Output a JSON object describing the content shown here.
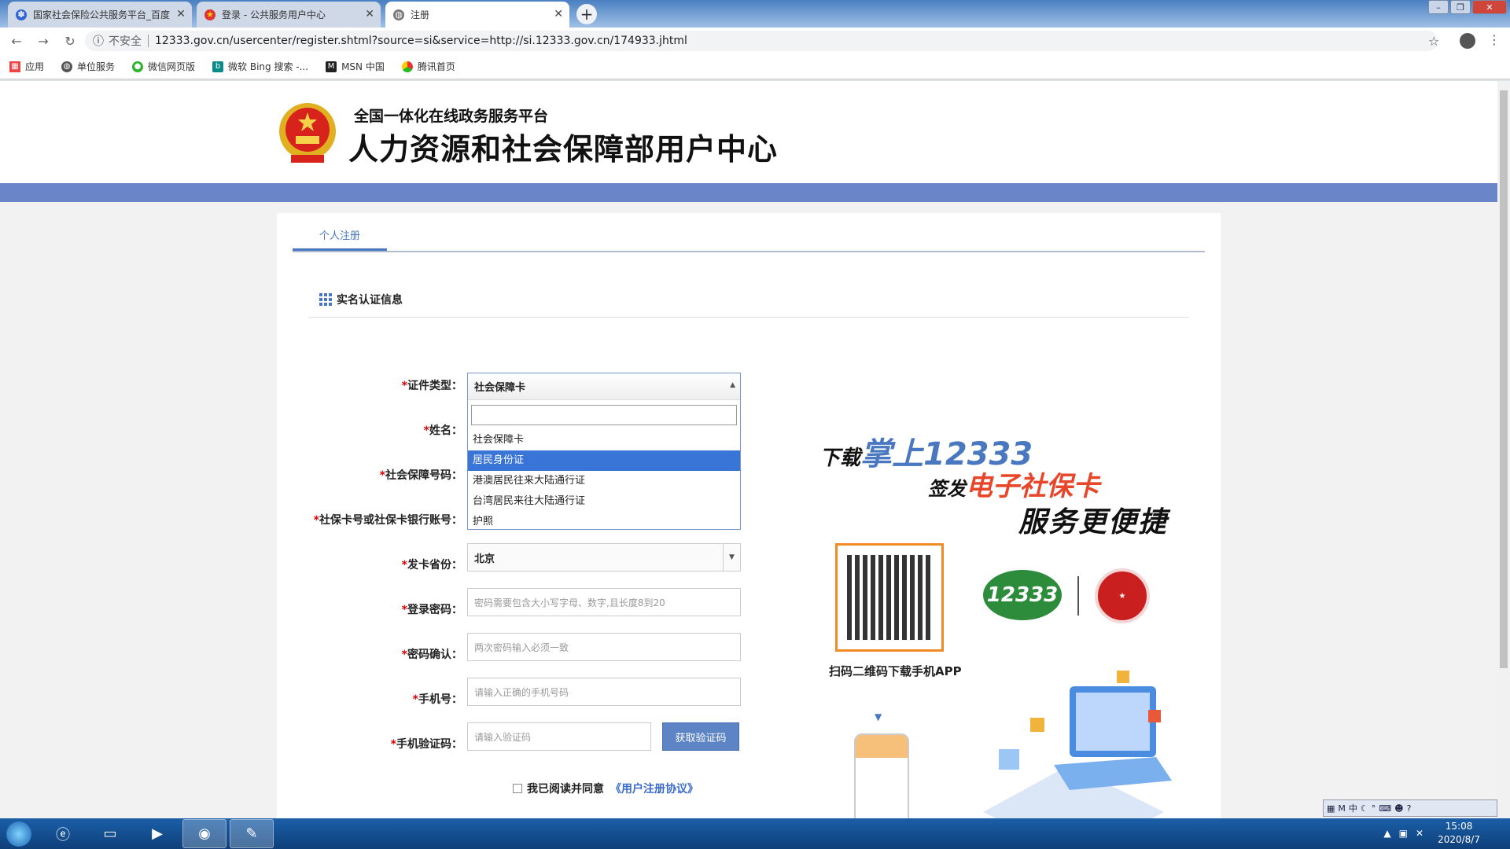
{
  "browser": {
    "tabs": [
      {
        "title": "国家社会保险公共服务平台_百度"
      },
      {
        "title": "登录 - 公共服务用户中心"
      },
      {
        "title": "注册"
      }
    ],
    "insecure_label": "不安全",
    "url": "12333.gov.cn/usercenter/register.shtml?source=si&service=http://si.12333.gov.cn/174933.jhtml",
    "bookmarks": [
      "应用",
      "单位服务",
      "微信网页版",
      "微软 Bing 搜索 -...",
      "MSN 中国",
      "腾讯首页"
    ]
  },
  "header": {
    "subtitle": "全国一体化在线政务服务平台",
    "title": "人力资源和社会保障部用户中心"
  },
  "tabs": {
    "personal": "个人注册"
  },
  "section": {
    "title": "实名认证信息"
  },
  "form": {
    "id_type": {
      "label": "证件类型",
      "value": "社会保障卡"
    },
    "name": {
      "label": "姓名"
    },
    "ss_number": {
      "label": "社会保障号码"
    },
    "card_account": {
      "label": "社保卡号或社保卡银行账号"
    },
    "province": {
      "label": "发卡省份",
      "value": "北京"
    },
    "password": {
      "label": "登录密码",
      "placeholder": "密码需要包含大小写字母、数字,且长度8到20"
    },
    "confirm": {
      "label": "密码确认",
      "placeholder": "两次密码输入必须一致"
    },
    "phone": {
      "label": "手机号",
      "placeholder": "请输入正确的手机号码"
    },
    "vcode": {
      "label": "手机验证码",
      "placeholder": "请输入验证码",
      "button": "获取验证码"
    },
    "agree": {
      "text": "我已阅读并同意",
      "link": "《用户注册协议》"
    },
    "colon": "："
  },
  "dropdown": {
    "options": [
      "社会保障卡",
      "居民身份证",
      "港澳居民往来大陆通行证",
      "台湾居民来往大陆通行证",
      "护照"
    ],
    "highlighted": "居民身份证"
  },
  "promo": {
    "line1_a": "下载",
    "line1_b": "掌上12333",
    "line2_a": "签发",
    "line2_b": "电子社保卡",
    "line3": "服务更便捷",
    "scan": "扫码二维码下载手机APP",
    "logo": "12333"
  },
  "taskbar": {
    "time": "15:08",
    "date": "2020/8/7"
  },
  "colors": {
    "accent": "#4a78c0",
    "header_bar": "#6a86c8",
    "required": "#dd0000"
  }
}
